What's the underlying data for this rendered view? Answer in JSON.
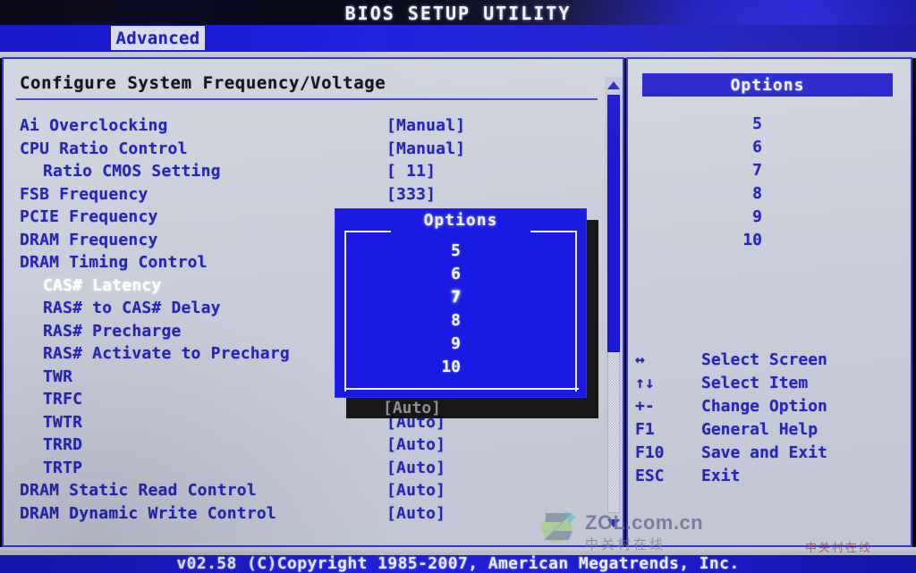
{
  "window": {
    "title": "BIOS SETUP UTILITY",
    "active_tab": "Advanced"
  },
  "main": {
    "page_title": "Configure System Frequency/Voltage",
    "rows": [
      {
        "label": "Ai Overclocking",
        "value": "[Manual]",
        "indent": false,
        "selected": false
      },
      {
        "label": "CPU Ratio Control",
        "value": "[Manual]",
        "indent": false,
        "selected": false
      },
      {
        "label": "Ratio CMOS Setting",
        "value": "[  11]",
        "indent": true,
        "selected": false
      },
      {
        "label": "FSB Frequency",
        "value": "[333]",
        "indent": false,
        "selected": false
      },
      {
        "label": "PCIE Frequency",
        "value": "",
        "indent": false,
        "selected": false
      },
      {
        "label": "DRAM Frequency",
        "value": "",
        "indent": false,
        "selected": false
      },
      {
        "label": "DRAM Timing Control",
        "value": "",
        "indent": false,
        "selected": false
      },
      {
        "label": "CAS# Latency",
        "value": "",
        "indent": true,
        "selected": true
      },
      {
        "label": "RAS# to CAS# Delay",
        "value": "",
        "indent": true,
        "selected": false
      },
      {
        "label": "RAS# Precharge",
        "value": "",
        "indent": true,
        "selected": false
      },
      {
        "label": "RAS# Activate to Precharg",
        "value": "",
        "indent": true,
        "selected": false
      },
      {
        "label": "TWR",
        "value": "",
        "indent": true,
        "selected": false
      },
      {
        "label": "TRFC",
        "value": "",
        "indent": true,
        "selected": false
      },
      {
        "label": "TWTR",
        "value": "[Auto]",
        "indent": true,
        "selected": false
      },
      {
        "label": "TRRD",
        "value": "[Auto]",
        "indent": true,
        "selected": false
      },
      {
        "label": "TRTP",
        "value": "[Auto]",
        "indent": true,
        "selected": false
      },
      {
        "label": "DRAM Static Read Control",
        "value": "[Auto]",
        "indent": false,
        "selected": false
      },
      {
        "label": "DRAM Dynamic Write Control",
        "value": "[Auto]",
        "indent": false,
        "selected": false
      }
    ],
    "shadowed_value": "[Auto]"
  },
  "popup": {
    "title": "Options",
    "items": [
      "5",
      "6",
      "7",
      "8",
      "9",
      "10"
    ],
    "selected": "7"
  },
  "help_panel": {
    "header": "Options",
    "options": [
      "5",
      "6",
      "7",
      "8",
      "9",
      "10"
    ],
    "legend": [
      {
        "key": "↔",
        "text": "Select Screen"
      },
      {
        "key": "↑↓",
        "text": "Select Item"
      },
      {
        "key": "+-",
        "text": "Change Option"
      },
      {
        "key": "F1",
        "text": "General Help"
      },
      {
        "key": "F10",
        "text": "Save and Exit"
      },
      {
        "key": "ESC",
        "text": "Exit"
      }
    ]
  },
  "footer": {
    "text": "v02.58 (C)Copyright 1985-2007, American Megatrends, Inc."
  },
  "watermark": {
    "text": "ZOL.com.cn",
    "subtext": "中关村在线",
    "corner": "中关村在线"
  },
  "colors": {
    "accent_blue": "#2424cc",
    "text_blue": "#2626b8",
    "panel_bg": "#ccd0dc",
    "popup_bg": "#1a1ae2"
  }
}
